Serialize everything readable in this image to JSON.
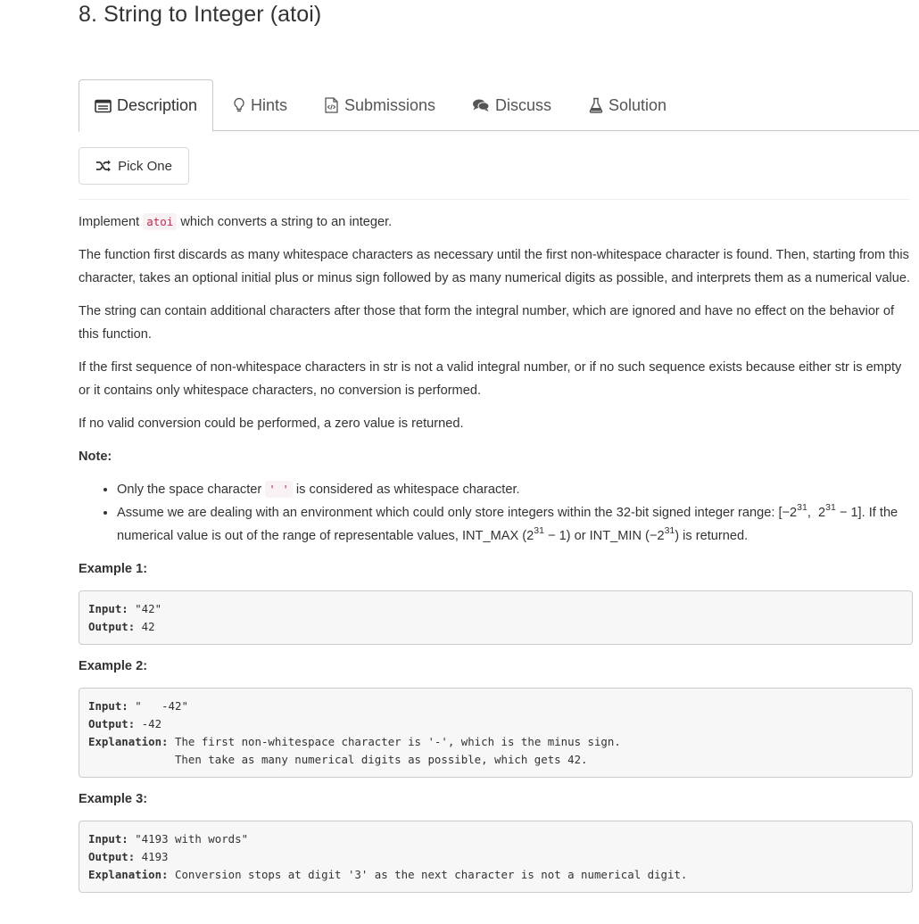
{
  "problem": {
    "title": "8. String to Integer (atoi)"
  },
  "tabs": [
    {
      "label": "Description",
      "icon": "description-icon",
      "active": true
    },
    {
      "label": "Hints",
      "icon": "lightbulb-icon"
    },
    {
      "label": "Submissions",
      "icon": "code-file-icon"
    },
    {
      "label": "Discuss",
      "icon": "comments-icon"
    },
    {
      "label": "Solution",
      "icon": "flask-icon"
    }
  ],
  "pick_one": {
    "label": "Pick One",
    "icon": "shuffle-icon"
  },
  "description": {
    "p1_before": "Implement ",
    "p1_code": "atoi",
    "p1_after": " which converts a string to an integer.",
    "p2": "The function first discards as many whitespace characters as necessary until the first non-whitespace character is found. Then, starting from this character, takes an optional initial plus or minus sign followed by as many numerical digits as possible, and interprets them as a numerical value.",
    "p3": "The string can contain additional characters after those that form the integral number, which are ignored and have no effect on the behavior of this function.",
    "p4": "If the first sequence of non-whitespace characters in str is not a valid integral number, or if no such sequence exists because either str is empty or it contains only whitespace characters, no conversion is performed.",
    "p5": "If no valid conversion could be performed, a zero value is returned."
  },
  "note": {
    "heading": "Note:",
    "item1_before": "Only the space character ",
    "item1_code": "' '",
    "item1_after": " is considered as whitespace character.",
    "item2_a": "Assume we are dealing with an environment which could only store integers within the 32-bit signed integer range: [−2",
    "item2_sup1": "31",
    "item2_b": ",  2",
    "item2_sup2": "31",
    "item2_c": " − 1]. If the numerical value is out of the range of representable values, INT_MAX (2",
    "item2_sup3": "31",
    "item2_d": " − 1) or INT_MIN (−2",
    "item2_sup4": "31",
    "item2_e": ") is returned."
  },
  "examples": [
    {
      "heading": "Example 1:",
      "input_label": "Input:",
      "input": " \"42\"",
      "output_label": "Output:",
      "output": " 42"
    },
    {
      "heading": "Example 2:",
      "input_label": "Input:",
      "input": " \"   -42\"",
      "output_label": "Output:",
      "output": " -42",
      "explanation_label": "Explanation:",
      "explanation": " The first non-whitespace character is '-', which is the minus sign.\n             Then take as many numerical digits as possible, which gets 42."
    },
    {
      "heading": "Example 3:",
      "input_label": "Input:",
      "input": " \"4193 with words\"",
      "output_label": "Output:",
      "output": " 4193",
      "explanation_label": "Explanation:",
      "explanation": " Conversion stops at digit '3' as the next character is not a numerical digit."
    }
  ]
}
